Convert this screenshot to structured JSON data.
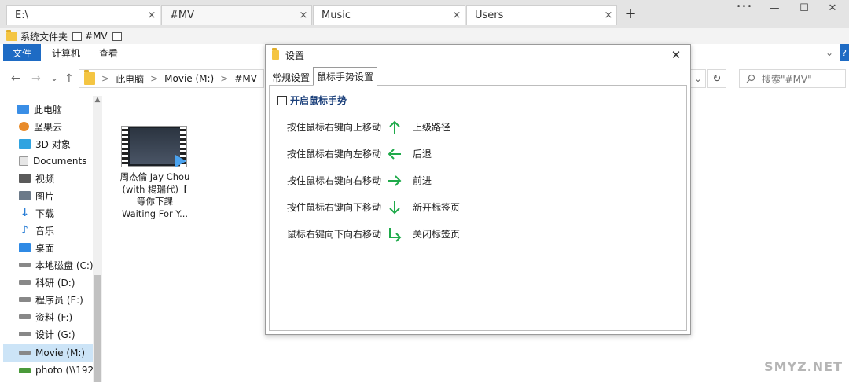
{
  "tabs": [
    {
      "label": "E:\\",
      "close": "×"
    },
    {
      "label": "#MV",
      "close": "×"
    },
    {
      "label": "Music",
      "close": "×"
    },
    {
      "label": "Users",
      "close": "×"
    }
  ],
  "new_tab": "+",
  "window_controls": {
    "more": "•••",
    "minimize": "—",
    "maximize": "☐",
    "close": "✕"
  },
  "bookmarks": [
    {
      "label": "系统文件夹"
    },
    {
      "label": "#MV"
    }
  ],
  "ribbon": {
    "file": "文件",
    "computer": "计算机",
    "view": "查看"
  },
  "address": {
    "crumbs": [
      "此电脑",
      "Movie (M:)",
      "#MV"
    ],
    "sep": ">",
    "search_placeholder": "搜索\"#MV\""
  },
  "nav": {
    "back": "←",
    "forward": "→",
    "recent": "⌄",
    "up": "↑",
    "refresh": "↻",
    "dropdown": "⌄"
  },
  "sidebar": {
    "items": [
      {
        "label": "此电脑",
        "icon": "computer-icon",
        "color": "#3a8ee6"
      },
      {
        "label": "坚果云",
        "icon": "nutstore-icon",
        "color": "#e88b2a"
      },
      {
        "label": "3D 对象",
        "icon": "cube-icon",
        "color": "#2fa3e0"
      },
      {
        "label": "Documents",
        "icon": "document-icon",
        "color": "#c7c7c7"
      },
      {
        "label": "视频",
        "icon": "video-icon",
        "color": "#5a5a5a"
      },
      {
        "label": "图片",
        "icon": "picture-icon",
        "color": "#6c7a89"
      },
      {
        "label": "下载",
        "icon": "download-icon",
        "color": "#2b7fd6"
      },
      {
        "label": "音乐",
        "icon": "music-icon",
        "color": "#2b7fd6"
      },
      {
        "label": "桌面",
        "icon": "desktop-icon",
        "color": "#2f8ae5"
      },
      {
        "label": "本地磁盘 (C:)",
        "icon": "drive-icon",
        "color": "#777777"
      },
      {
        "label": "科研 (D:)",
        "icon": "drive-icon",
        "color": "#777777"
      },
      {
        "label": "程序员 (E:)",
        "icon": "drive-icon",
        "color": "#777777"
      },
      {
        "label": "资料 (F:)",
        "icon": "drive-icon",
        "color": "#777777"
      },
      {
        "label": "设计 (G:)",
        "icon": "drive-icon",
        "color": "#777777"
      },
      {
        "label": "Movie (M:)",
        "icon": "drive-icon",
        "color": "#777777"
      },
      {
        "label": "photo (\\\\192",
        "icon": "network-drive-icon",
        "color": "#4a9a3a"
      }
    ],
    "selected_index": 14
  },
  "file": {
    "name_lines": [
      "周杰倫 Jay Chou",
      "(with 楊瑞代)【",
      "等你下課",
      "Waiting For Y..."
    ]
  },
  "dialog": {
    "title": "设置",
    "close": "✕",
    "tabs": [
      "常规设置",
      "鼠标手势设置"
    ],
    "active_tab": 1,
    "enable_label": "开启鼠标手势",
    "gestures": [
      {
        "desc": "按住鼠标右键向上移动",
        "arrow": "arrow-up",
        "action": "上级路径"
      },
      {
        "desc": "按住鼠标右键向左移动",
        "arrow": "arrow-left",
        "action": "后退"
      },
      {
        "desc": "按住鼠标右键向右移动",
        "arrow": "arrow-right",
        "action": "前进"
      },
      {
        "desc": "按住鼠标右键向下移动",
        "arrow": "arrow-down",
        "action": "新开标签页"
      },
      {
        "desc": "鼠标右键向下向右移动",
        "arrow": "arrow-down-right",
        "action": "关闭标签页"
      }
    ],
    "arrow_color": "#1faa4a"
  },
  "watermark": "SMYZ.NET"
}
